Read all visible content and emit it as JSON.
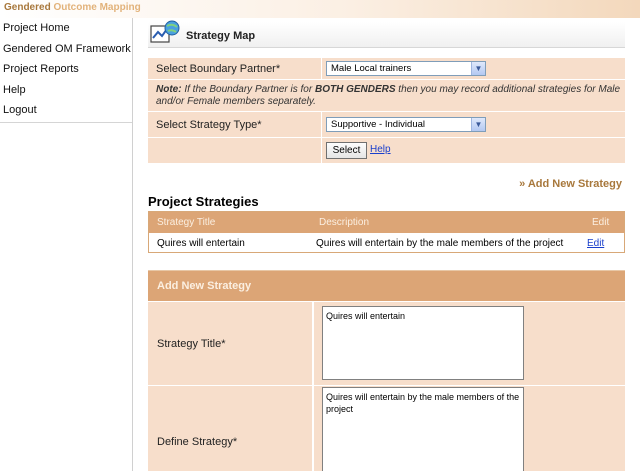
{
  "app": {
    "brand_part1": "Gendered",
    "brand_part2": "Outcome Mapping"
  },
  "sidebar": {
    "items": [
      {
        "label": "Project Home"
      },
      {
        "label": "Gendered OM Framework"
      },
      {
        "label": "Project Reports"
      },
      {
        "label": "Help"
      },
      {
        "label": "Logout"
      }
    ]
  },
  "strategy_map": {
    "title": "Strategy Map",
    "boundary_partner_label": "Select Boundary Partner*",
    "boundary_partner_value": "Male Local trainers",
    "note_prefix": "Note:",
    "note_part1": " If the Boundary Partner is for ",
    "note_bold": "BOTH GENDERS",
    "note_part2": " then you may record additional strategies for Male and/or Female members separately.",
    "strategy_type_label": "Select Strategy Type*",
    "strategy_type_value": "Supportive - Individual",
    "select_button": "Select",
    "help_link": "Help",
    "add_new_link": "» Add New Strategy"
  },
  "project_strategies": {
    "title": "Project Strategies",
    "columns": [
      "Strategy Title",
      "Description",
      "Edit"
    ],
    "rows": [
      {
        "title": "Quires will entertain",
        "description": "Quires will entertain by the male members of the project",
        "edit": "Edit"
      }
    ]
  },
  "new_strategy": {
    "header": "Add New Strategy",
    "title_label": "Strategy Title*",
    "title_value": "Quires will entertain",
    "define_label": "Define Strategy*",
    "define_value": "Quires will entertain by the male members of the project"
  },
  "colors": {
    "accent": "#dca576",
    "panel": "#f7decb",
    "brand": "#a8783c",
    "link": "#1a3fcc"
  }
}
